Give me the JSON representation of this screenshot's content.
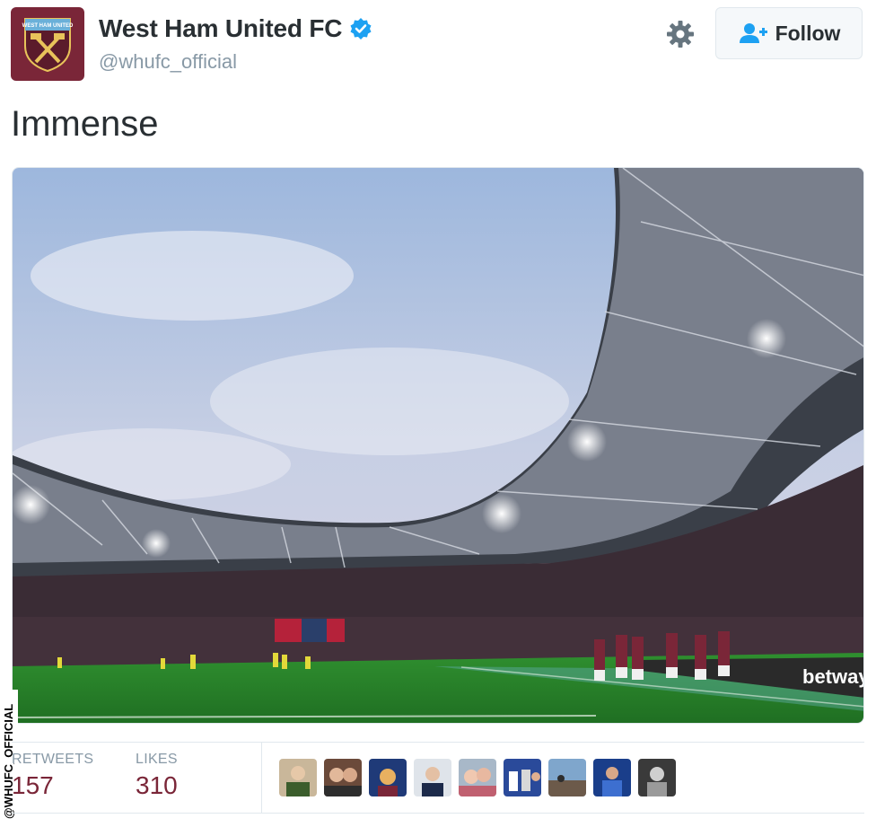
{
  "account": {
    "display_name": "West Ham United FC",
    "handle": "@whufc_official",
    "verified": true,
    "crest_text": "WEST HAM UNITED",
    "brand_color": "#7a2638"
  },
  "header": {
    "follow_label": "Follow",
    "settings_icon": "gear-icon",
    "follow_icon": "add-user-icon"
  },
  "tweet": {
    "text": "Immense",
    "photo_sign": "betway"
  },
  "stats": {
    "retweets_label": "RETWEETS",
    "retweets_value": "157",
    "likes_label": "LIKES",
    "likes_value": "310"
  },
  "likers_count_shown": 9,
  "watermark": "@WHUFC_OFFICIAL",
  "colors": {
    "verified_blue": "#1da1f2",
    "value_color": "#7a2638",
    "muted": "#8899a6"
  }
}
